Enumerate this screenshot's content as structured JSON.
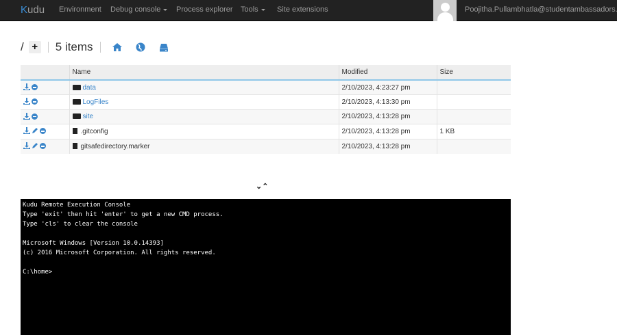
{
  "nav": {
    "brand_first": "K",
    "brand_rest": "udu",
    "items": [
      "Environment",
      "Debug console",
      "Process explorer",
      "Tools",
      "Site extensions"
    ],
    "user": "Poojitha.Pullambhatla@studentambassadors.com"
  },
  "breadcrumb": {
    "root": "/",
    "add": "+",
    "count": "5 items"
  },
  "table": {
    "headers": [
      "",
      "Name",
      "Modified",
      "Size"
    ],
    "rows": [
      {
        "name": "data",
        "type": "folder",
        "modified": "2/10/2023, 4:23:27 pm",
        "size": ""
      },
      {
        "name": "LogFiles",
        "type": "folder",
        "modified": "2/10/2023, 4:13:30 pm",
        "size": ""
      },
      {
        "name": "site",
        "type": "folder",
        "modified": "2/10/2023, 4:13:28 pm",
        "size": ""
      },
      {
        "name": ".gitconfig",
        "type": "file",
        "modified": "2/10/2023, 4:13:28 pm",
        "size": "1 KB"
      },
      {
        "name": "gitsafedirectory.marker",
        "type": "file",
        "modified": "2/10/2023, 4:13:28 pm",
        "size": ""
      }
    ]
  },
  "console": {
    "lines": [
      "Kudu Remote Execution Console",
      "Type 'exit' then hit 'enter' to get a new CMD process.",
      "Type 'cls' to clear the console",
      "",
      "Microsoft Windows [Version 10.0.14393]",
      "(c) 2016 Microsoft Corporation. All rights reserved.",
      "",
      "C:\\home>"
    ]
  }
}
